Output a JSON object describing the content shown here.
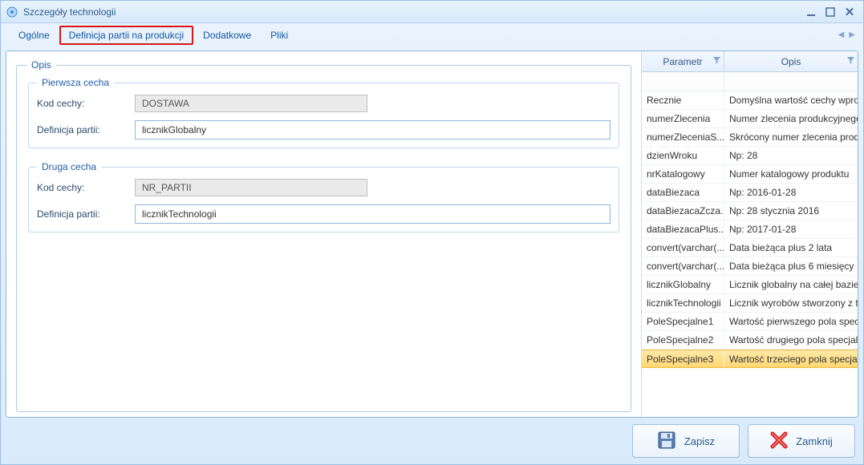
{
  "window": {
    "title": "Szczegóły technologii"
  },
  "tabs": {
    "t0": "Ogólne",
    "t1": "Definicja partii na produkcji",
    "t2": "Dodatkowe",
    "t3": "Pliki"
  },
  "opis_legend": "Opis",
  "first": {
    "legend": "Pierwsza cecha",
    "kod_label": "Kod cechy:",
    "kod_value": "DOSTAWA",
    "def_label": "Definicja partii:",
    "def_value": "licznikGlobalny"
  },
  "second": {
    "legend": "Druga cecha",
    "kod_label": "Kod cechy:",
    "kod_value": "NR_PARTII",
    "def_label": "Definicja partii:",
    "def_value": "licznikTechnologii"
  },
  "table": {
    "col_param": "Parametr",
    "col_opis": "Opis",
    "rows": [
      {
        "param": "Recznie",
        "opis": "Domyślna wartość cechy wpro..."
      },
      {
        "param": "numerZlecenia",
        "opis": "Numer zlecenia produkcyjnego"
      },
      {
        "param": "numerZleceniaS...",
        "opis": "Skrócony numer zlecenia prod..."
      },
      {
        "param": "dzienWroku",
        "opis": "Np: 28"
      },
      {
        "param": "nrKatalogowy",
        "opis": "Numer katalogowy produktu"
      },
      {
        "param": "dataBiezaca",
        "opis": "Np: 2016-01-28"
      },
      {
        "param": "dataBiezacaZcza...",
        "opis": "Np: 28 stycznia 2016"
      },
      {
        "param": "dataBiezacaPlus...",
        "opis": "Np: 2017-01-28"
      },
      {
        "param": "convert(varchar(...",
        "opis": "Data bieżąca plus 2 lata"
      },
      {
        "param": "convert(varchar(...",
        "opis": "Data bieżąca plus 6 miesięcy"
      },
      {
        "param": "licznikGlobalny",
        "opis": "Licznik globalny na całej bazie"
      },
      {
        "param": "licznikTechnologii",
        "opis": "Licznik wyrobów stworzony z t..."
      },
      {
        "param": "PoleSpecjalne1",
        "opis": "Wartość pierwszego pola specj..."
      },
      {
        "param": "PoleSpecjalne2",
        "opis": "Wartość drugiego pola specjal..."
      },
      {
        "param": "PoleSpecjalne3",
        "opis": "Wartość trzeciego pola specjal...",
        "selected": true
      }
    ]
  },
  "footer": {
    "save": "Zapisz",
    "close": "Zamknij"
  }
}
